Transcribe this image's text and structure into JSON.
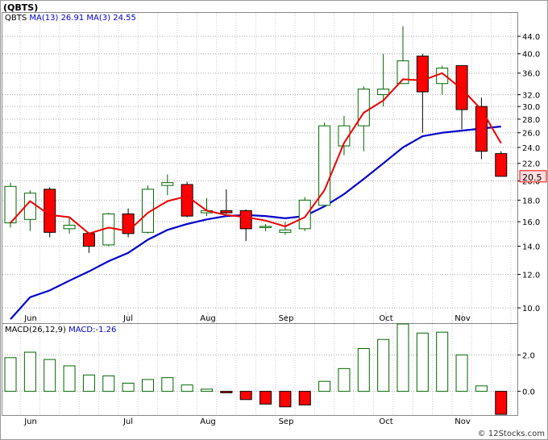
{
  "header": {
    "title": "(QBTS)",
    "symbol": "QBTS",
    "ma13_label": "MA(13)",
    "ma13_value": "26.91",
    "ma3_label": "MA(3)",
    "ma3_value": "24.55"
  },
  "macd_header": {
    "params": "MACD(26,12,9)",
    "value_label": "MACD:-1.26"
  },
  "footer": {
    "credit": "© 12Stocks.com"
  },
  "colors": {
    "up_fill": "#ffffff",
    "up_stroke": "#006600",
    "down_fill": "#ff0000",
    "down_stroke": "#000000",
    "ma13": "#0000cc",
    "ma3": "#ee0000",
    "macd_up": "#006600",
    "macd_down": "#ff0000",
    "last_price_box": "#ffdddd"
  },
  "chart_data": {
    "type": "candlestick",
    "price_scale": "log",
    "ylim": [
      9.2,
      50
    ],
    "y_ticks": [
      10.0,
      12.0,
      14.0,
      16.0,
      18.0,
      20.0,
      22.0,
      24.0,
      26.0,
      28.0,
      30.0,
      32.0,
      36.0,
      40.0,
      44.0
    ],
    "last_price": "20.5",
    "x_labels": [
      "Jun",
      "Jul",
      "Aug",
      "Sep",
      "Oct",
      "Nov"
    ],
    "candles": [
      {
        "o": 15.9,
        "h": 19.8,
        "l": 15.5,
        "c": 19.4
      },
      {
        "o": 16.2,
        "h": 19.0,
        "l": 15.2,
        "c": 18.7
      },
      {
        "o": 19.1,
        "h": 19.3,
        "l": 14.7,
        "c": 15.1
      },
      {
        "o": 15.4,
        "h": 16.4,
        "l": 15.0,
        "c": 15.7
      },
      {
        "o": 15.0,
        "h": 15.1,
        "l": 13.5,
        "c": 14.0
      },
      {
        "o": 14.1,
        "h": 16.8,
        "l": 14.0,
        "c": 16.7
      },
      {
        "o": 16.7,
        "h": 17.2,
        "l": 14.7,
        "c": 15.0
      },
      {
        "o": 15.1,
        "h": 19.5,
        "l": 15.0,
        "c": 19.1
      },
      {
        "o": 19.5,
        "h": 20.7,
        "l": 18.5,
        "c": 19.8
      },
      {
        "o": 19.6,
        "h": 19.9,
        "l": 16.4,
        "c": 16.5
      },
      {
        "o": 16.8,
        "h": 18.2,
        "l": 16.5,
        "c": 17.0
      },
      {
        "o": 17.0,
        "h": 19.1,
        "l": 16.7,
        "c": 16.8
      },
      {
        "o": 17.0,
        "h": 17.1,
        "l": 14.4,
        "c": 15.4
      },
      {
        "o": 15.5,
        "h": 15.8,
        "l": 15.2,
        "c": 15.6
      },
      {
        "o": 15.1,
        "h": 16.0,
        "l": 14.9,
        "c": 15.3
      },
      {
        "o": 15.4,
        "h": 18.3,
        "l": 15.2,
        "c": 18.0
      },
      {
        "o": 17.5,
        "h": 27.5,
        "l": 17.4,
        "c": 27.0
      },
      {
        "o": 24.2,
        "h": 28.5,
        "l": 23.0,
        "c": 27.0
      },
      {
        "o": 27.0,
        "h": 33.5,
        "l": 23.5,
        "c": 33.0
      },
      {
        "o": 32.0,
        "h": 40.0,
        "l": 30.0,
        "c": 33.0
      },
      {
        "o": 34.0,
        "h": 46.5,
        "l": 34.0,
        "c": 38.5
      },
      {
        "o": 39.5,
        "h": 40.0,
        "l": 26.0,
        "c": 32.5
      },
      {
        "o": 34.0,
        "h": 37.5,
        "l": 32.0,
        "c": 37.0
      },
      {
        "o": 37.5,
        "h": 37.5,
        "l": 26.5,
        "c": 29.5
      },
      {
        "o": 30.0,
        "h": 31.5,
        "l": 22.5,
        "c": 23.5
      },
      {
        "o": 23.2,
        "h": 23.5,
        "l": 20.5,
        "c": 20.5
      }
    ],
    "ma13": [
      9.4,
      10.6,
      11.0,
      11.6,
      12.2,
      12.9,
      13.5,
      14.5,
      15.3,
      15.8,
      16.2,
      16.5,
      16.6,
      16.5,
      16.3,
      16.5,
      17.4,
      18.6,
      20.2,
      22.0,
      24.0,
      25.5,
      26.0,
      26.3,
      26.6,
      26.9
    ],
    "ma3": [
      15.9,
      17.9,
      16.6,
      16.4,
      15.0,
      15.5,
      15.2,
      16.8,
      17.9,
      18.4,
      17.0,
      16.6,
      16.4,
      16.1,
      15.6,
      16.4,
      19.0,
      24.6,
      29.0,
      31.0,
      34.8,
      34.6,
      36.0,
      33.0,
      29.5,
      24.55
    ],
    "macd_ylim": [
      -1.3,
      3.7
    ],
    "macd_ticks": [
      0.0,
      2.0
    ],
    "macd_hist": [
      1.85,
      2.15,
      1.75,
      1.4,
      0.9,
      0.85,
      0.45,
      0.65,
      0.75,
      0.35,
      0.12,
      -0.08,
      -0.45,
      -0.7,
      -0.85,
      -0.75,
      0.55,
      1.25,
      2.35,
      2.85,
      3.7,
      3.2,
      3.25,
      2.0,
      0.3,
      -1.26
    ]
  }
}
